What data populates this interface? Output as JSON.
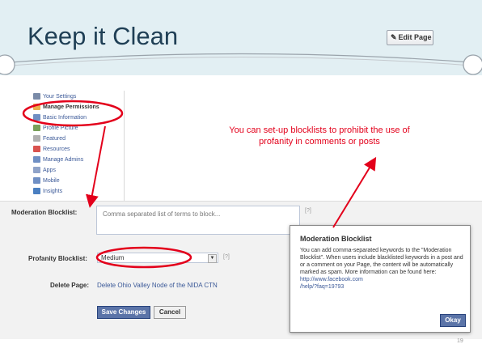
{
  "slide": {
    "title": "Keep it Clean",
    "slide_number": "19",
    "annotation": "You can set-up blocklists to prohibit the use of profanity in comments or posts"
  },
  "header": {
    "edit_page_label": "Edit Page",
    "edit_page_icon": "pencil-icon"
  },
  "sidebar": {
    "items": [
      {
        "label": "Your Settings",
        "icon": "settings-icon",
        "color": "#7a8ba8"
      },
      {
        "label": "Manage Permissions",
        "icon": "lock-icon",
        "color": "#e9b04b",
        "active": true
      },
      {
        "label": "Basic Information",
        "icon": "info-icon",
        "color": "#6f8fc4"
      },
      {
        "label": "Profile Picture",
        "icon": "picture-icon",
        "color": "#7aa05a"
      },
      {
        "label": "Featured",
        "icon": "star-icon",
        "color": "#b0b0b0"
      },
      {
        "label": "Resources",
        "icon": "resources-icon",
        "color": "#d9534f"
      },
      {
        "label": "Manage Admins",
        "icon": "admins-icon",
        "color": "#6f8fc4"
      },
      {
        "label": "Apps",
        "icon": "apps-icon",
        "color": "#8fa3c9"
      },
      {
        "label": "Mobile",
        "icon": "mobile-icon",
        "color": "#6f8fc4"
      },
      {
        "label": "Insights",
        "icon": "insights-icon",
        "color": "#4a7fc1"
      }
    ]
  },
  "form": {
    "moderation_label": "Moderation Blocklist:",
    "moderation_placeholder": "Comma separated list of terms to block...",
    "moderation_help": "[?]",
    "profanity_label": "Profanity Blocklist:",
    "profanity_value": "Medium",
    "profanity_help": "[?]",
    "delete_label": "Delete Page:",
    "delete_link": "Delete Ohio Valley Node of the NIDA CTN",
    "save_label": "Save Changes",
    "cancel_label": "Cancel"
  },
  "tooltip": {
    "title": "Moderation Blocklist",
    "body": "You can add comma-separated keywords to the \"Moderation Blocklist\". When users include blacklisted keywords in a post and or a comment on your Page, the content will be automatically marked as spam. More information can be found here: ",
    "link_part1": "http://www.facebook.com",
    "link_part2": "/help/?faq=19793",
    "okay_label": "Okay"
  },
  "colors": {
    "header_band": "#e2eff3",
    "title": "#1f3f55",
    "annotation_red": "#e3001b",
    "fb_blue": "#3b5998",
    "button_blue": "#5b74a8"
  }
}
